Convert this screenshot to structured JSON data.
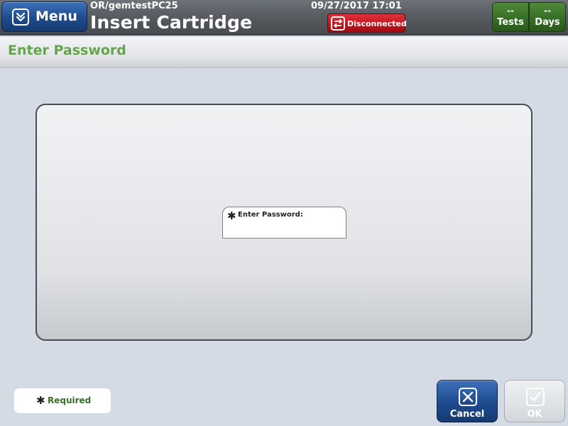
{
  "header": {
    "menu_label": "Menu",
    "device_name": "OR/gemtestPC25",
    "screen_title": "Insert Cartridge",
    "datetime": "09/27/2017 17:01",
    "connection_status": "Disconnected",
    "tests": {
      "value": "--",
      "label": "Tests"
    },
    "days": {
      "value": "--",
      "label": "Days"
    }
  },
  "subheader": {
    "title": "Enter Password"
  },
  "form": {
    "required_mark": "✱",
    "password_label": "Enter Password:"
  },
  "footer": {
    "required_mark": "✱",
    "required_label": "Required",
    "cancel_label": "Cancel",
    "ok_label": "OK"
  },
  "colors": {
    "accent_blue": "#1e4b8e",
    "status_red": "#c0141e",
    "counter_green": "#356b24",
    "title_green": "#65a64a"
  }
}
